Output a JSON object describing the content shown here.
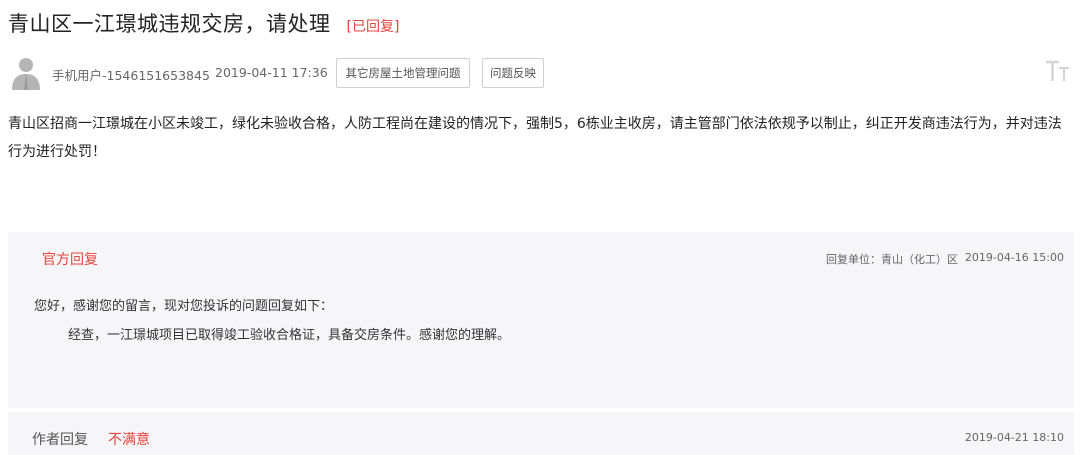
{
  "post": {
    "title": "青山区一江璟城违规交房，请处理",
    "status": "[已回复]",
    "author": "手机用户-1546151653845",
    "time": "2019-04-11 17:36",
    "tags": [
      "其它房屋土地管理问题",
      "问题反映"
    ],
    "content": "青山区招商一江璟城在小区未竣工，绿化未验收合格，人防工程尚在建设的情况下，强制5，6栋业主收房，请主管部门依法依规予以制止，纠正开发商违法行为，并对违法行为进行处罚！",
    "font_toggle_icon": "text-size-icon"
  },
  "official_reply": {
    "label": "官方回复",
    "unit": "回复单位：青山（化工）区",
    "time": "2019-04-16 15:00",
    "greeting": "您好，感谢您的留言，现对您投诉的问题回复如下：",
    "body": "经查，一江璟城项目已取得竣工验收合格证，具备交房条件。感谢您的理解。"
  },
  "author_reply": {
    "label": "作者回复",
    "satisfaction": "不满意",
    "time": "2019-04-21 18:10"
  },
  "colors": {
    "accent_red": "#e8443b",
    "reply_bg": "#f6f6f8"
  }
}
